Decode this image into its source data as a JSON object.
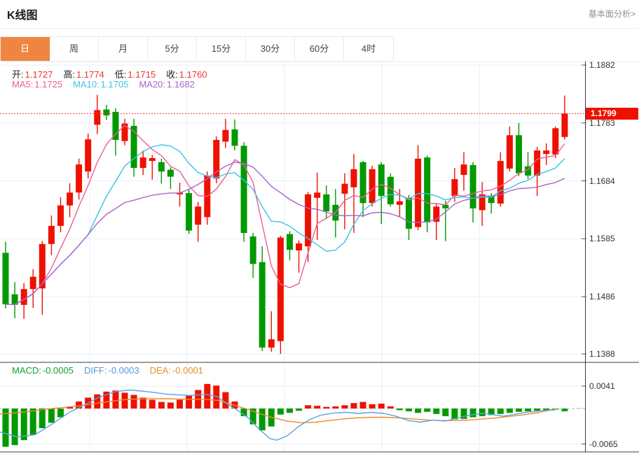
{
  "header": {
    "title": "K线图",
    "link_label": "基本面分析>"
  },
  "tabs": {
    "selected_index": 0,
    "items": [
      {
        "label": "日",
        "name": "day"
      },
      {
        "label": "周",
        "name": "week"
      },
      {
        "label": "月",
        "name": "month"
      },
      {
        "label": "5分",
        "name": "5min"
      },
      {
        "label": "15分",
        "name": "15min"
      },
      {
        "label": "30分",
        "name": "30min"
      },
      {
        "label": "60分",
        "name": "60min"
      },
      {
        "label": "4时",
        "name": "4hour"
      }
    ]
  },
  "legend": {
    "ohlc": [
      {
        "name": "open",
        "label": "开:",
        "value": "1.1727"
      },
      {
        "name": "high",
        "label": "高:",
        "value": "1.1774"
      },
      {
        "name": "low",
        "label": "低:",
        "value": "1.1715"
      },
      {
        "name": "close",
        "label": "收:",
        "value": "1.1760"
      }
    ],
    "ohlc_label_color": "#222222",
    "ohlc_value_color": "#f0342e",
    "ma": [
      {
        "name": "ma5",
        "label": "MA5:",
        "value": "1.1725",
        "color": "#ee5c9c"
      },
      {
        "name": "ma10",
        "label": "MA10:",
        "value": "1.1705",
        "color": "#3cc3e3"
      },
      {
        "name": "ma20",
        "label": "MA20:",
        "value": "1.1682",
        "color": "#a964c9"
      }
    ],
    "macd": [
      {
        "name": "macd",
        "label": "MACD:",
        "value": "-0.0005",
        "color": "#13a22d"
      },
      {
        "name": "diff",
        "label": "DIFF:",
        "value": "-0.0003",
        "color": "#4f9ae0"
      },
      {
        "name": "dea",
        "label": "DEA:",
        "value": "-0.0001",
        "color": "#f08a28"
      }
    ]
  },
  "price_axis": {
    "labels": [
      "1.1882",
      "1.1783",
      "1.1684",
      "1.1585",
      "1.1486",
      "1.1388"
    ],
    "values": [
      1.1882,
      1.1783,
      1.1684,
      1.1585,
      1.1486,
      1.1388
    ],
    "current_tag": {
      "label": "1.1799",
      "value": 1.1799,
      "bg": "#ee1100"
    }
  },
  "macd_axis": {
    "labels": [
      "0.0041",
      "-0.0065"
    ],
    "values": [
      41,
      -65
    ]
  },
  "colors": {
    "accent_orange": "#ef8540",
    "grid": "#e8eef6",
    "axis_dark": "#3c3c3c",
    "tick": "#555555",
    "dotted_price_line": "#f23a2e",
    "zero_dash": "#c9c9c9",
    "zero_dash_extension": "#a9d3ee"
  },
  "chart_data": {
    "type": "candlestick",
    "title": "K线图",
    "up_color": "#ee1100",
    "down_color": "#009a00",
    "price_range": {
      "top": 1.1882,
      "bottom": 1.1388
    },
    "current_price": 1.1799,
    "candles": [
      [
        1.1561,
        1.158,
        1.1466,
        1.1473
      ],
      [
        1.149,
        1.1511,
        1.1449,
        1.1472
      ],
      [
        1.1472,
        1.1509,
        1.1448,
        1.1499
      ],
      [
        1.1499,
        1.1533,
        1.1467,
        1.152
      ],
      [
        1.15,
        1.1581,
        1.1455,
        1.1576
      ],
      [
        1.1576,
        1.1625,
        1.1557,
        1.1607
      ],
      [
        1.1607,
        1.1656,
        1.1596,
        1.1642
      ],
      [
        1.1642,
        1.168,
        1.1622,
        1.1664
      ],
      [
        1.1664,
        1.1722,
        1.1652,
        1.1712
      ],
      [
        1.17,
        1.1765,
        1.1688,
        1.1755
      ],
      [
        1.178,
        1.1831,
        1.1764,
        1.1805
      ],
      [
        1.1806,
        1.1814,
        1.1788,
        1.1796
      ],
      [
        1.1802,
        1.1808,
        1.1727,
        1.1754
      ],
      [
        1.1752,
        1.179,
        1.1745,
        1.1782
      ],
      [
        1.1778,
        1.179,
        1.1691,
        1.1706
      ],
      [
        1.1706,
        1.1736,
        1.1694,
        1.1724
      ],
      [
        1.1718,
        1.1728,
        1.1686,
        1.1723
      ],
      [
        1.1716,
        1.1722,
        1.1679,
        1.17
      ],
      [
        1.1703,
        1.1707,
        1.167,
        1.1691
      ],
      [
        1.1661,
        1.1681,
        1.164,
        1.1664
      ],
      [
        1.1663,
        1.167,
        1.1593,
        1.1599
      ],
      [
        1.1609,
        1.1648,
        1.158,
        1.164
      ],
      [
        1.1622,
        1.17,
        1.1609,
        1.1693
      ],
      [
        1.1688,
        1.176,
        1.168,
        1.1754
      ],
      [
        1.1751,
        1.179,
        1.174,
        1.1771
      ],
      [
        1.1772,
        1.1789,
        1.1736,
        1.1744
      ],
      [
        1.1744,
        1.175,
        1.158,
        1.1595
      ],
      [
        1.1589,
        1.1595,
        1.1518,
        1.1542
      ],
      [
        1.1545,
        1.1572,
        1.1393,
        1.1399
      ],
      [
        1.1399,
        1.1461,
        1.1392,
        1.1413
      ],
      [
        1.141,
        1.159,
        1.1388,
        1.1587
      ],
      [
        1.1593,
        1.1598,
        1.1548,
        1.1566
      ],
      [
        1.1565,
        1.1582,
        1.1527,
        1.1577
      ],
      [
        1.1572,
        1.1665,
        1.1545,
        1.1661
      ],
      [
        1.1655,
        1.1698,
        1.1583,
        1.1664
      ],
      [
        1.1661,
        1.1676,
        1.162,
        1.1632
      ],
      [
        1.1643,
        1.167,
        1.1587,
        1.1616
      ],
      [
        1.1662,
        1.1697,
        1.1601,
        1.1679
      ],
      [
        1.1673,
        1.173,
        1.1595,
        1.1704
      ],
      [
        1.1716,
        1.1718,
        1.1622,
        1.1646
      ],
      [
        1.1646,
        1.171,
        1.164,
        1.1704
      ],
      [
        1.1712,
        1.1716,
        1.161,
        1.1658
      ],
      [
        1.1691,
        1.1697,
        1.164,
        1.1644
      ],
      [
        1.1643,
        1.167,
        1.1622,
        1.1649
      ],
      [
        1.1655,
        1.166,
        1.1583,
        1.1602
      ],
      [
        1.1605,
        1.1745,
        1.16,
        1.1722
      ],
      [
        1.1724,
        1.1727,
        1.1596,
        1.1613
      ],
      [
        1.1614,
        1.1645,
        1.1583,
        1.164
      ],
      [
        1.1643,
        1.165,
        1.1581,
        1.1637
      ],
      [
        1.1658,
        1.1706,
        1.1648,
        1.1687
      ],
      [
        1.1694,
        1.1733,
        1.1667,
        1.1712
      ],
      [
        1.1711,
        1.1716,
        1.1613,
        1.1637
      ],
      [
        1.1634,
        1.1682,
        1.1607,
        1.1661
      ],
      [
        1.1658,
        1.1663,
        1.1628,
        1.1646
      ],
      [
        1.1645,
        1.1733,
        1.164,
        1.1718
      ],
      [
        1.1705,
        1.1777,
        1.17,
        1.1762
      ],
      [
        1.1762,
        1.1783,
        1.1692,
        1.1697
      ],
      [
        1.1709,
        1.1733,
        1.1687,
        1.1693
      ],
      [
        1.1693,
        1.1742,
        1.1658,
        1.1736
      ],
      [
        1.173,
        1.1748,
        1.1711,
        1.1736
      ],
      [
        1.1729,
        1.1777,
        1.1723,
        1.1774
      ],
      [
        1.1759,
        1.183,
        1.1755,
        1.1799
      ]
    ],
    "ma_overlays": [
      {
        "period": 5,
        "color": "#ee5c9c"
      },
      {
        "period": 10,
        "color": "#3cc3e3"
      },
      {
        "period": 20,
        "color": "#a964c9"
      }
    ],
    "macd": {
      "unit": "1e-4",
      "ylim": [
        -65,
        41
      ],
      "hist": [
        -70,
        -67,
        -58,
        -48,
        -36,
        -26,
        -16,
        3,
        13,
        20,
        26,
        31,
        33,
        29,
        25,
        20,
        16,
        12,
        11,
        16,
        24,
        34,
        45,
        42,
        30,
        13,
        -14,
        -29,
        -40,
        -33,
        -11,
        -8,
        -4,
        6,
        5,
        3,
        4,
        6,
        10,
        12,
        8,
        9,
        4,
        -3,
        -5,
        -8,
        -6,
        -10,
        -14,
        -20,
        -19,
        -16,
        -14,
        -12,
        -10,
        -8,
        -6,
        -5,
        -4,
        -3,
        -2,
        -5
      ],
      "diff_color": "#5aa2e3",
      "dea_color": "#ef8929",
      "diff_points": [
        [
          0,
          -43
        ],
        [
          25,
          -52
        ],
        [
          50,
          -48
        ],
        [
          75,
          -28
        ],
        [
          100,
          -6
        ],
        [
          115,
          3
        ],
        [
          140,
          20
        ],
        [
          165,
          31
        ],
        [
          185,
          34
        ],
        [
          210,
          31
        ],
        [
          240,
          26
        ],
        [
          270,
          24
        ],
        [
          295,
          26
        ],
        [
          310,
          22
        ],
        [
          325,
          8
        ],
        [
          340,
          -4
        ],
        [
          355,
          -18
        ],
        [
          370,
          -38
        ],
        [
          385,
          -55
        ],
        [
          395,
          -58
        ],
        [
          410,
          -50
        ],
        [
          425,
          -34
        ],
        [
          442,
          -20
        ],
        [
          458,
          -12
        ],
        [
          478,
          -8
        ],
        [
          495,
          -7
        ],
        [
          512,
          -9
        ],
        [
          530,
          -7
        ],
        [
          548,
          -9
        ],
        [
          565,
          -14
        ],
        [
          583,
          -22
        ],
        [
          600,
          -25
        ],
        [
          618,
          -21
        ],
        [
          635,
          -23
        ],
        [
          652,
          -18
        ],
        [
          670,
          -12
        ],
        [
          688,
          -9
        ],
        [
          703,
          -11
        ],
        [
          718,
          -14
        ],
        [
          733,
          -11
        ],
        [
          750,
          -7
        ],
        [
          765,
          -5
        ],
        [
          780,
          -3
        ],
        [
          792,
          -3
        ]
      ],
      "dea_points": [
        [
          0,
          -10
        ],
        [
          30,
          -7
        ],
        [
          60,
          -2
        ],
        [
          90,
          2
        ],
        [
          115,
          5
        ],
        [
          145,
          11
        ],
        [
          175,
          16
        ],
        [
          205,
          18
        ],
        [
          235,
          18
        ],
        [
          265,
          17
        ],
        [
          290,
          17
        ],
        [
          310,
          15
        ],
        [
          330,
          8
        ],
        [
          350,
          0
        ],
        [
          370,
          -9
        ],
        [
          390,
          -17
        ],
        [
          410,
          -23
        ],
        [
          430,
          -26
        ],
        [
          450,
          -25
        ],
        [
          470,
          -22
        ],
        [
          490,
          -19
        ],
        [
          510,
          -17
        ],
        [
          530,
          -16
        ],
        [
          550,
          -16
        ],
        [
          570,
          -17
        ],
        [
          590,
          -19
        ],
        [
          610,
          -21
        ],
        [
          630,
          -22
        ],
        [
          650,
          -22
        ],
        [
          670,
          -21
        ],
        [
          690,
          -19
        ],
        [
          710,
          -17
        ],
        [
          730,
          -14
        ],
        [
          750,
          -11
        ],
        [
          770,
          -7
        ],
        [
          792,
          -1
        ]
      ]
    }
  }
}
